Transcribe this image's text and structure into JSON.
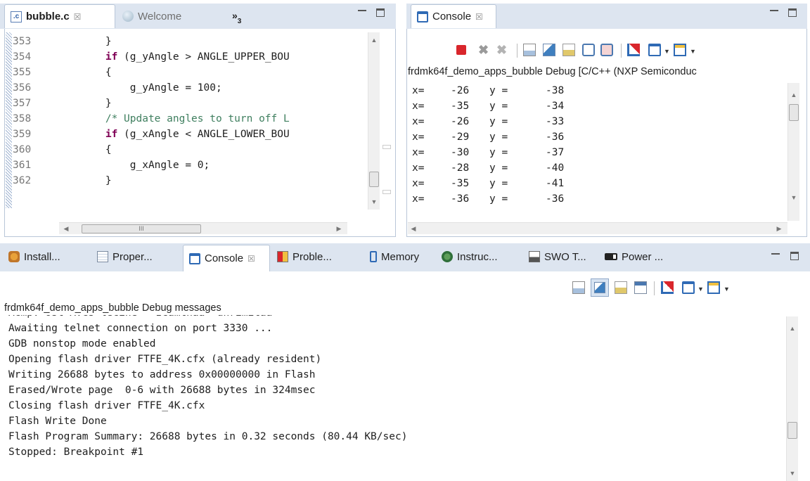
{
  "editor": {
    "tabs": [
      {
        "label": "bubble.c",
        "close": "☒"
      },
      {
        "label": "Welcome"
      }
    ],
    "overflow": "»",
    "overflow_count": "3",
    "line_numbers": [
      "353",
      "354",
      "355",
      "356",
      "357",
      "358",
      "359",
      "360",
      "361",
      "362"
    ],
    "code": [
      "        }",
      "        if (g_yAngle > ANGLE_UPPER_BOU",
      "        {",
      "            g_yAngle = 100;",
      "        }",
      "        /* Update angles to turn off L",
      "        if (g_xAngle < ANGLE_LOWER_BOU",
      "        {",
      "            g_xAngle = 0;",
      "        }"
    ],
    "hscroll_mark": "III"
  },
  "console_top": {
    "tab_label": "Console",
    "close": "☒",
    "title": "frdmk64f_demo_apps_bubble Debug [C/C++ (NXP Semiconduc",
    "rows": [
      {
        "x": "x=",
        "xv": "-26",
        "y": "y =",
        "yv": "-38"
      },
      {
        "x": "x=",
        "xv": "-35",
        "y": "y =",
        "yv": "-34"
      },
      {
        "x": "x=",
        "xv": "-26",
        "y": "y =",
        "yv": "-33"
      },
      {
        "x": "x=",
        "xv": "-29",
        "y": "y =",
        "yv": "-36"
      },
      {
        "x": "x=",
        "xv": "-30",
        "y": "y =",
        "yv": "-37"
      },
      {
        "x": "x=",
        "xv": "-28",
        "y": "y =",
        "yv": "-40"
      },
      {
        "x": "x=",
        "xv": "-35",
        "y": "y =",
        "yv": "-41"
      },
      {
        "x": "x=",
        "xv": "-36",
        "y": "y =",
        "yv": "-36"
      }
    ]
  },
  "bottom": {
    "tabs": [
      "Install...",
      "Proper...",
      "Console",
      "Proble...",
      "Memory",
      "Instruc...",
      "SWO T...",
      "Power ..."
    ],
    "console_close": "☒",
    "title": "frdmk64f_demo_apps_bubble Debug messages",
    "partial_line": "Acmp: ost A.Gs lecine   Icamtnaa  unrimitaa",
    "lines": [
      "Awaiting telnet connection on port 3330 ...",
      "GDB nonstop mode enabled",
      "Opening flash driver FTFE_4K.cfx (already resident)",
      "Writing 26688 bytes to address 0x00000000 in Flash",
      "Erased/Wrote page  0-6 with 26688 bytes in 324msec",
      "Closing flash driver FTFE_4K.cfx",
      "Flash Write Done",
      "Flash Program Summary: 26688 bytes in 0.32 seconds (80.44 KB/sec)",
      "Stopped: Breakpoint #1"
    ]
  },
  "icons": {
    "accent_blue": "#2f6ab5",
    "terminate_red": "#d9262c"
  }
}
